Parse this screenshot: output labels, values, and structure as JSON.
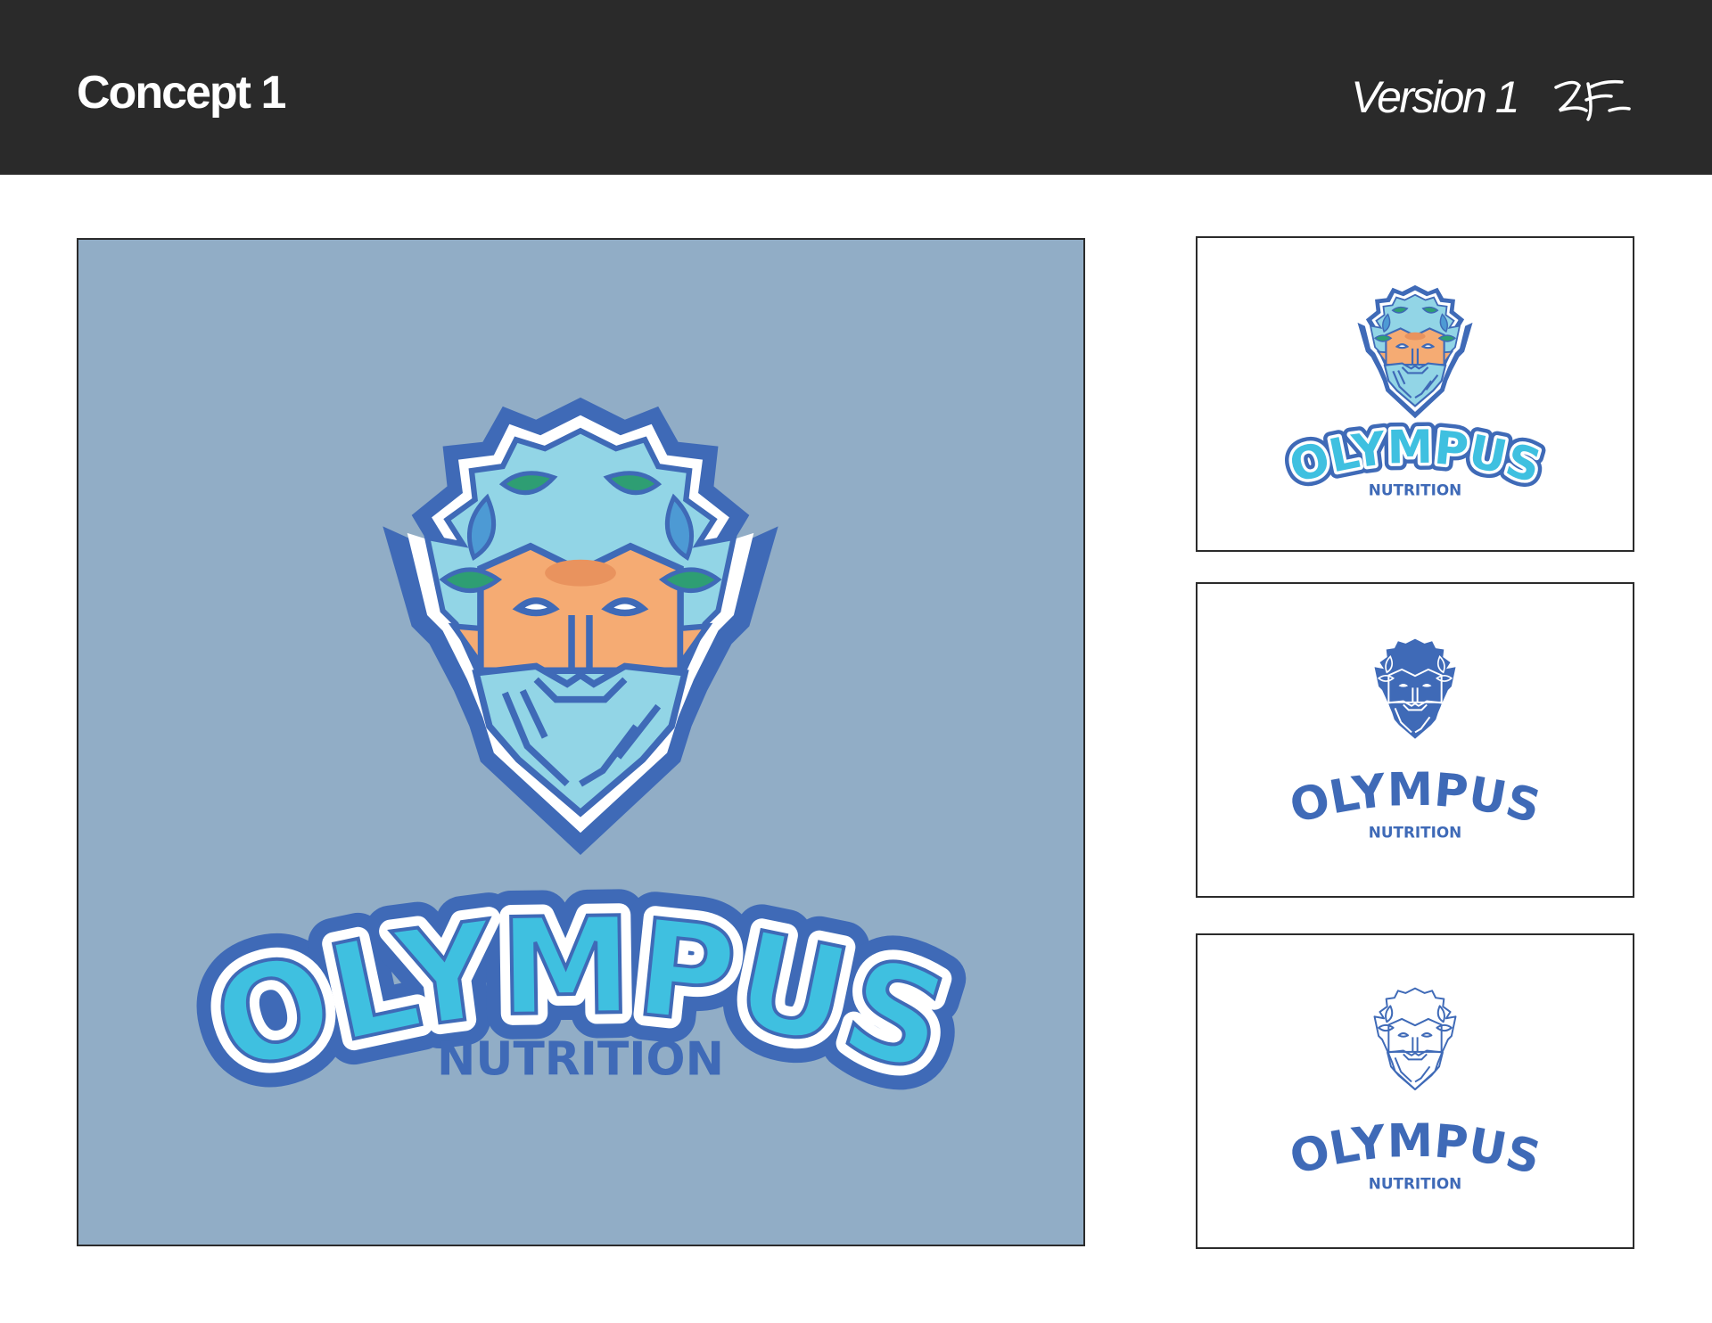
{
  "header": {
    "title": "Concept 1",
    "version": "Version 1",
    "signature_icon": "signature-mark"
  },
  "logo": {
    "wordmark": "OLYMPUS",
    "subtitle": "NUTRITION",
    "icon": "zeus-head-icon"
  },
  "variants": [
    {
      "name": "full-color-on-background",
      "background": "#91adc6"
    },
    {
      "name": "full-color-on-white",
      "background": "#ffffff"
    },
    {
      "name": "solid-blue",
      "background": "#ffffff"
    },
    {
      "name": "blue-outline",
      "background": "#ffffff"
    }
  ],
  "colors": {
    "header_bg": "#2a2a2a",
    "stage_bg": "#91adc6",
    "dark_blue": "#3f6ab7",
    "light_blue": "#92d5e6",
    "cyan": "#3fc0e0",
    "skin": "#f5ab73",
    "leaf_green": "#2e9e73",
    "leaf_teal": "#4d9ad4"
  }
}
